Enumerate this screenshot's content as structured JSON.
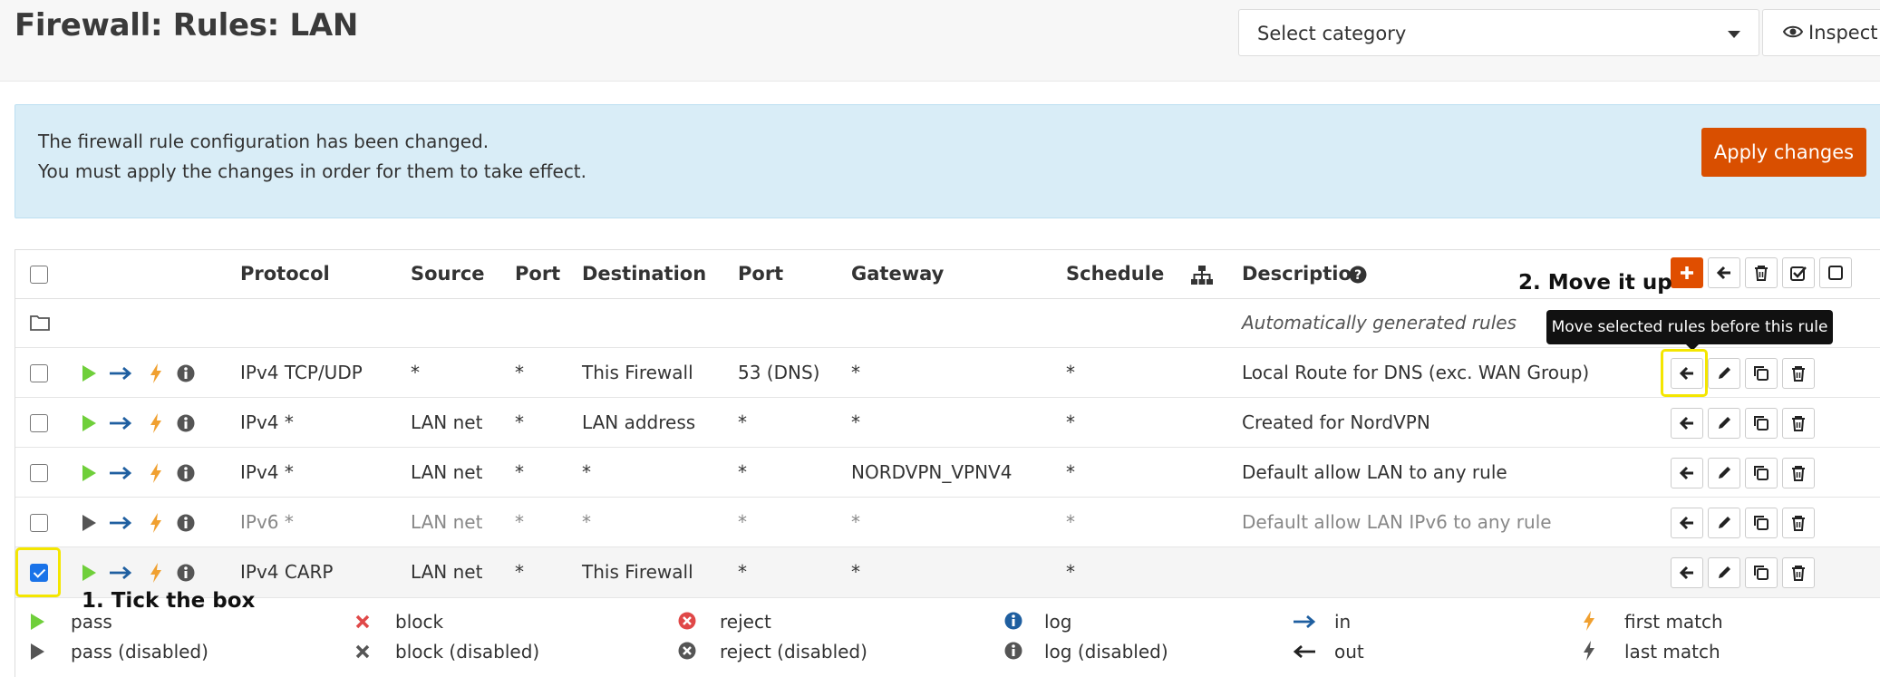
{
  "header": {
    "title": "Firewall: Rules: LAN",
    "category_select": "Select category",
    "inspect_label": "Inspect"
  },
  "alert": {
    "line1": "The firewall rule configuration has been changed.",
    "line2": "You must apply the changes in order for them to take effect.",
    "apply_label": "Apply changes"
  },
  "table": {
    "columns": [
      "Protocol",
      "Source",
      "Port",
      "Destination",
      "Port",
      "Gateway",
      "Schedule",
      "Description"
    ],
    "auto_rules_label": "Automatically generated rules",
    "rows": [
      {
        "protocol": "IPv4 TCP/UDP",
        "source": "*",
        "src_port": "*",
        "destination": "This Firewall",
        "dst_port": "53 (DNS)",
        "gateway": "*",
        "schedule": "*",
        "description": "Local Route for DNS (exc. WAN Group)",
        "checked": false,
        "disabled": false
      },
      {
        "protocol": "IPv4 *",
        "source": "LAN net",
        "src_port": "*",
        "destination": "LAN address",
        "dst_port": "*",
        "gateway": "*",
        "schedule": "*",
        "description": "Created for NordVPN",
        "checked": false,
        "disabled": false
      },
      {
        "protocol": "IPv4 *",
        "source": "LAN net",
        "src_port": "*",
        "destination": "*",
        "dst_port": "*",
        "gateway": "NORDVPN_VPNV4",
        "schedule": "*",
        "description": "Default allow LAN to any rule",
        "checked": false,
        "disabled": false
      },
      {
        "protocol": "IPv6 *",
        "source": "LAN net",
        "src_port": "*",
        "destination": "*",
        "dst_port": "*",
        "gateway": "*",
        "schedule": "*",
        "description": "Default allow LAN IPv6 to any rule",
        "checked": false,
        "disabled": true
      },
      {
        "protocol": "IPv4 CARP",
        "source": "LAN net",
        "src_port": "*",
        "destination": "This Firewall",
        "dst_port": "*",
        "gateway": "*",
        "schedule": "*",
        "description": "",
        "checked": true,
        "disabled": false
      }
    ]
  },
  "tooltip": "Move selected rules before this rule",
  "annotations": {
    "step1": "1. Tick the box",
    "step2": "2. Move it up"
  },
  "legend": {
    "pass": "pass",
    "pass_disabled": "pass (disabled)",
    "block": "block",
    "block_disabled": "block (disabled)",
    "reject": "reject",
    "reject_disabled": "reject (disabled)",
    "log": "log",
    "log_disabled": "log (disabled)",
    "in": "in",
    "out": "out",
    "first_match": "first match",
    "last_match": "last match"
  },
  "colors": {
    "accent": "#d94f00",
    "pass": "#6fcf3a",
    "arrow": "#1f5fa0",
    "bolt": "#f0a030",
    "block": "#e04848",
    "highlight": "#f4e600"
  }
}
